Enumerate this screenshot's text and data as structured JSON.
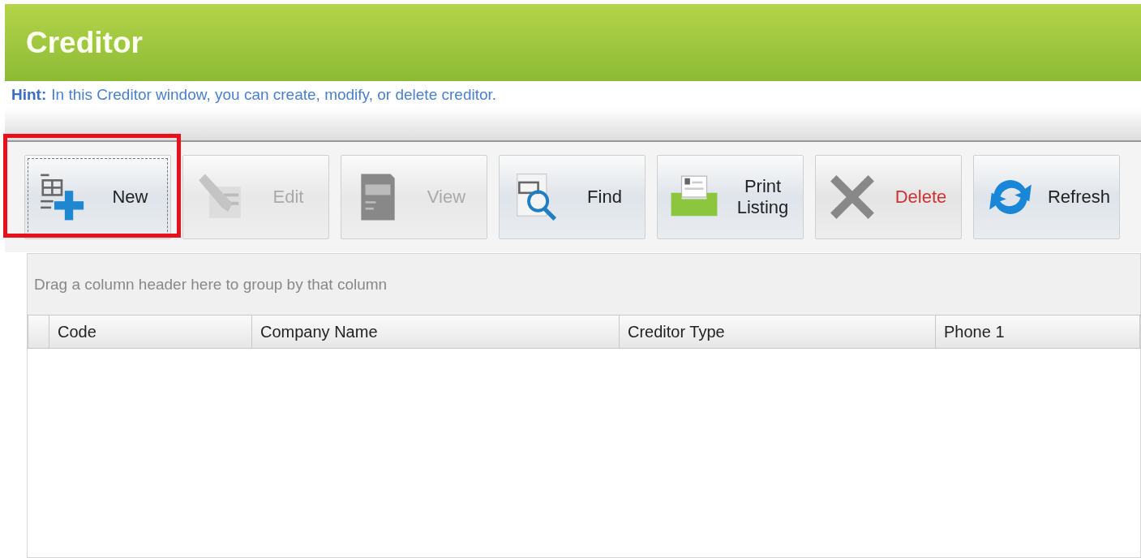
{
  "window": {
    "title": "Creditor"
  },
  "hint": {
    "label": "Hint:",
    "text": "In this Creditor window, you can create, modify, or delete creditor."
  },
  "toolbar": [
    {
      "kind": "new",
      "label": "New",
      "disabled": false,
      "highlighted": true
    },
    {
      "kind": "edit",
      "label": "Edit",
      "disabled": true,
      "highlighted": false
    },
    {
      "kind": "view",
      "label": "View",
      "disabled": true,
      "highlighted": false
    },
    {
      "kind": "find",
      "label": "Find",
      "disabled": false,
      "highlighted": false
    },
    {
      "kind": "print",
      "label": "Print Listing",
      "disabled": false,
      "highlighted": false
    },
    {
      "kind": "delete",
      "label": "Delete",
      "disabled": false,
      "highlighted": false
    },
    {
      "kind": "refresh",
      "label": "Refresh",
      "disabled": false,
      "highlighted": false
    }
  ],
  "grid": {
    "group_panel": "Drag a column header here to group by that column",
    "columns": [
      "Code",
      "Company Name",
      "Creditor Type",
      "Phone 1"
    ]
  }
}
